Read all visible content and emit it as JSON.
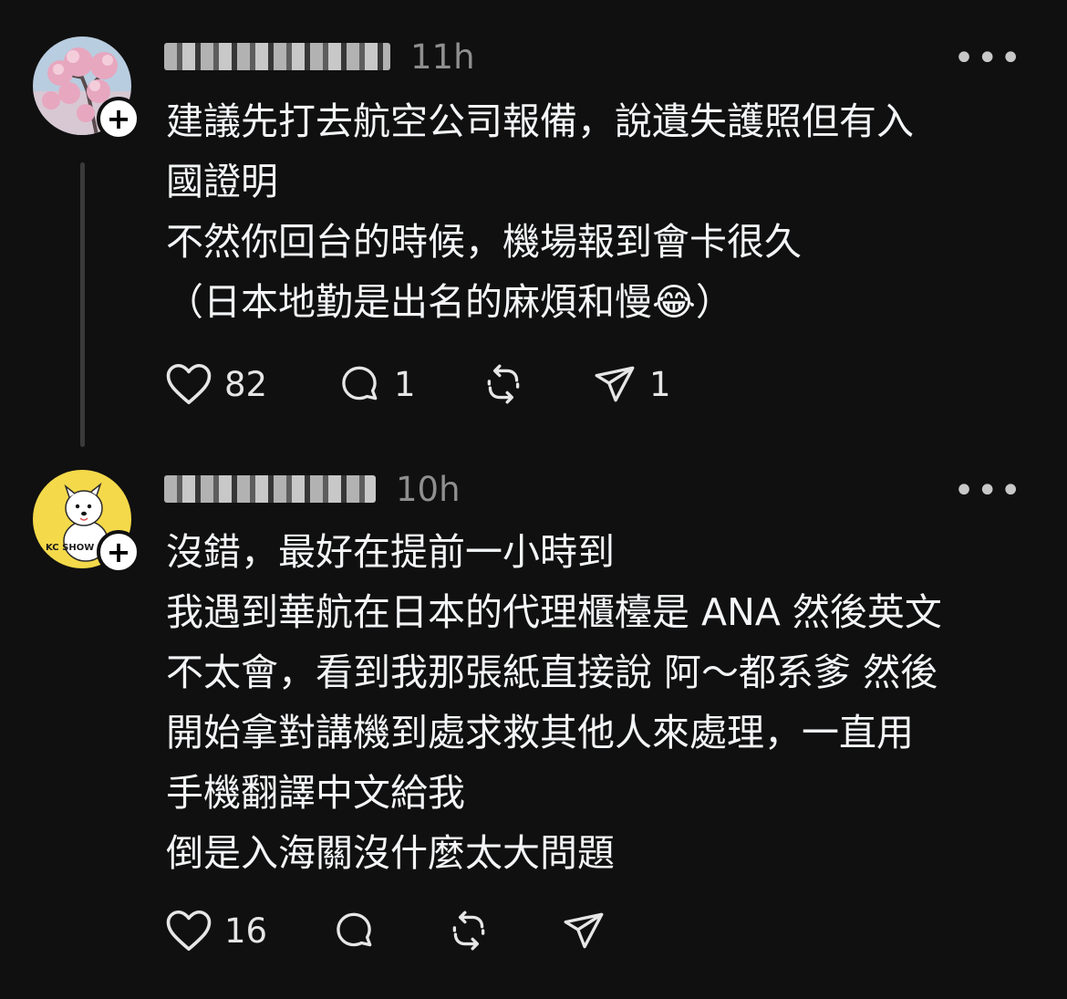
{
  "posts": [
    {
      "username": "",
      "timestamp": "11h",
      "more_label": "•••",
      "follow_label": "+",
      "body": [
        "建議先打去航空公司報備，說遺失護照但有入",
        "國證明",
        "不然你回台的時候，機場報到會卡很久",
        "（日本地勤是出名的麻煩和慢😂）"
      ],
      "likes": "82",
      "replies": "1",
      "reposts": "",
      "shares": "1",
      "avatar_icon": "cherry-blossom-photo"
    },
    {
      "username": "",
      "timestamp": "10h",
      "more_label": "•••",
      "follow_label": "+",
      "avatar_text": "KC SHOW",
      "body": [
        "沒錯，最好在提前一小時到",
        "我遇到華航在日本的代理櫃檯是 ANA 然後英文",
        "不太會，看到我那張紙直接說 阿～都系爹 然後",
        "開始拿對講機到處求救其他人來處理，一直用",
        "手機翻譯中文給我",
        "倒是入海關沒什麼太大問題"
      ],
      "likes": "16",
      "replies": "",
      "reposts": "",
      "shares": "",
      "avatar_icon": "white-dog-illustration"
    }
  ],
  "colors": {
    "background": "#101010",
    "text": "#f3f5f7",
    "muted": "#8f8f8f",
    "thread_line": "#3a3a3a",
    "avatar_yellow": "#f4d94a"
  },
  "icons": [
    "heart-icon",
    "comment-icon",
    "repost-icon",
    "share-icon",
    "more-icon",
    "follow-plus-icon"
  ]
}
